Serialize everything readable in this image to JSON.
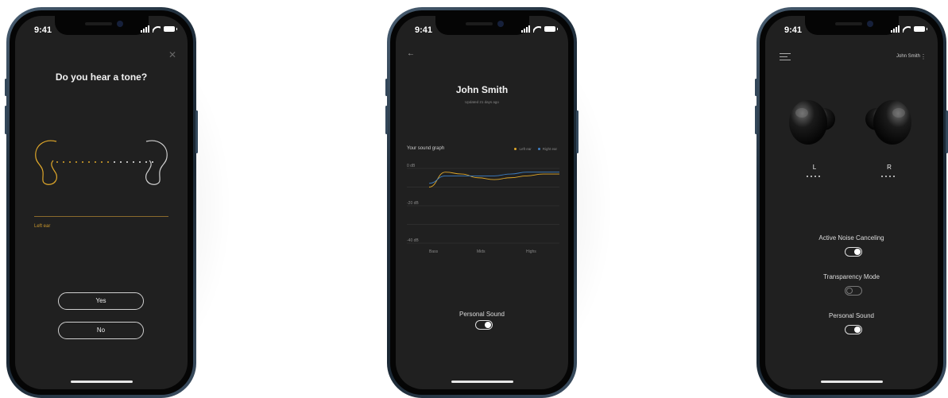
{
  "status": {
    "time": "9:41"
  },
  "screen1": {
    "title": "Do you hear a tone?",
    "ear_label": "Left ear",
    "yes_label": "Yes",
    "no_label": "No"
  },
  "screen2": {
    "name": "John Smith",
    "updated": "Updated 21 days ago",
    "graph_title": "Your sound graph",
    "legend_left": "Left ear",
    "legend_right": "Right ear",
    "personal_sound_label": "Personal Sound",
    "personal_sound_on": true
  },
  "screen3": {
    "user": "John Smith",
    "left_label": "L",
    "right_label": "R",
    "anc_label": "Active Noise Canceling",
    "anc_on": true,
    "transparency_label": "Transparency Mode",
    "transparency_on": false,
    "personal_sound_label": "Personal Sound",
    "personal_sound_on": true
  },
  "colors": {
    "left_ear": "#e0a82a",
    "right_ear": "#3d7fc4",
    "screen_bg": "#202020"
  },
  "chart_data": {
    "type": "line",
    "title": "Your sound graph",
    "y_ticks": [
      "0 dB",
      "-20 dB",
      "-40 dB"
    ],
    "ylim": [
      -40,
      0
    ],
    "x_ticks": [
      "Bass",
      "Mids",
      "Highs"
    ],
    "legend_position": "top-right",
    "series": [
      {
        "name": "Left ear",
        "color": "#e0a82a",
        "values": [
          -10,
          -2,
          -3,
          -5,
          -6,
          -5,
          -4,
          -3,
          -3
        ]
      },
      {
        "name": "Right ear",
        "color": "#3d7fc4",
        "values": [
          -8,
          -4,
          -4,
          -4,
          -4,
          -3,
          -2,
          -2,
          -2
        ]
      }
    ]
  }
}
